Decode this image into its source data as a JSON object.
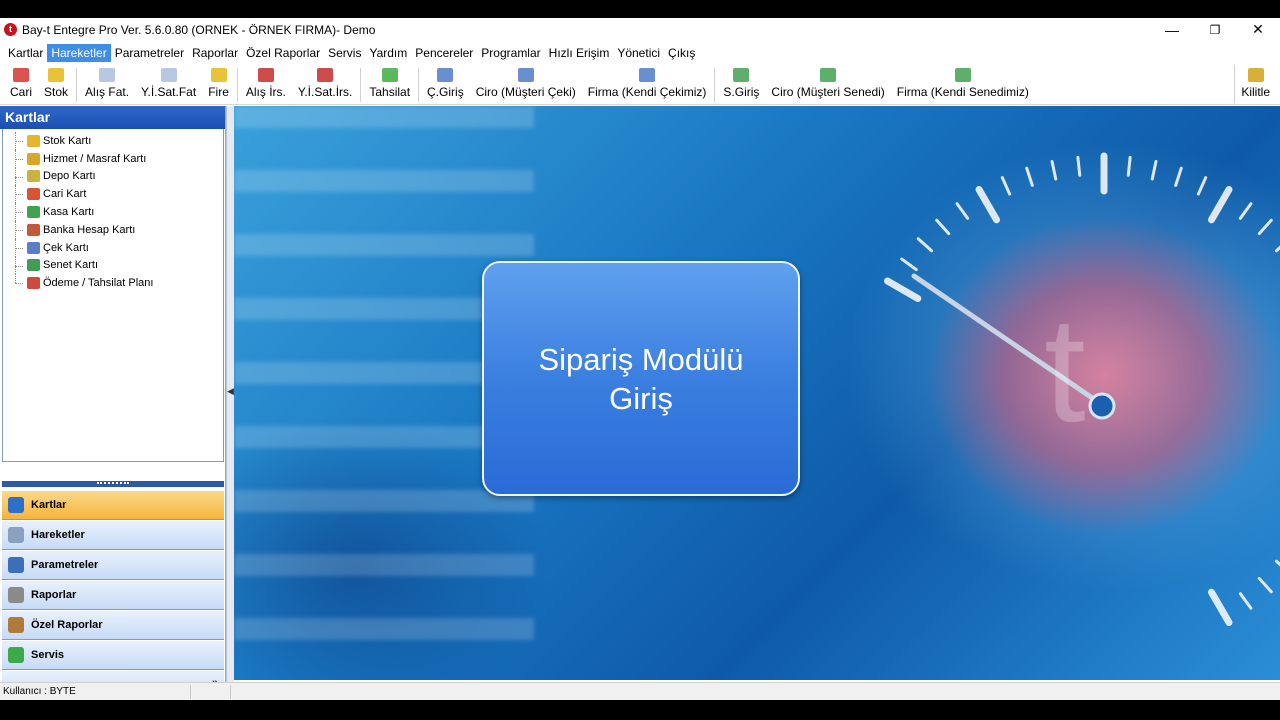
{
  "window": {
    "title": "Bay-t Entegre Pro Ver. 5.6.0.80 (ORNEK - ÖRNEK FIRMA)- Demo",
    "app_icon": "t",
    "controls": {
      "minimize": "—",
      "restore": "❐",
      "close": "✕"
    }
  },
  "menu": {
    "items": [
      {
        "label": "Kartlar"
      },
      {
        "label": "Hareketler",
        "active": true
      },
      {
        "label": "Parametreler"
      },
      {
        "label": "Raporlar"
      },
      {
        "label": "Özel Raporlar"
      },
      {
        "label": "Servis"
      },
      {
        "label": "Yardım"
      },
      {
        "label": "Pencereler"
      },
      {
        "label": "Programlar"
      },
      {
        "label": "Hızlı Erişim"
      },
      {
        "label": "Yönetici"
      },
      {
        "label": "Çıkış"
      }
    ]
  },
  "toolbar": {
    "buttons": [
      {
        "label": "Cari",
        "icon": "people-icon",
        "color": "#d9534f"
      },
      {
        "label": "Stok",
        "icon": "box-icon",
        "color": "#e8c33a"
      },
      {
        "label": "Alış Fat.",
        "icon": "invoice-icon",
        "color": "#b8c8e0"
      },
      {
        "label": "Y.İ.Sat.Fat",
        "icon": "invoice-icon",
        "color": "#b8c8e0"
      },
      {
        "label": "Fire",
        "icon": "box-icon",
        "color": "#e8c33a"
      },
      {
        "label": "Alış İrs.",
        "icon": "truck-icon",
        "color": "#cc4b4b"
      },
      {
        "label": "Y.İ.Sat.İrs.",
        "icon": "truck-icon",
        "color": "#cc4b4b"
      },
      {
        "label": "Tahsilat",
        "icon": "money-icon",
        "color": "#5cb85c"
      },
      {
        "label": "Ç.Giriş",
        "icon": "check-pen-icon",
        "color": "#6a8fd0"
      },
      {
        "label": "Ciro (Müşteri Çeki)",
        "icon": "check-pen-icon",
        "color": "#6a8fd0"
      },
      {
        "label": "Firma (Kendi Çekimiz)",
        "icon": "check-pen-icon",
        "color": "#6a8fd0"
      },
      {
        "label": "S.Giriş",
        "icon": "bill-icon",
        "color": "#5fae6a"
      },
      {
        "label": "Ciro (Müşteri Senedi)",
        "icon": "bill-icon",
        "color": "#5fae6a"
      },
      {
        "label": "Firma (Kendi Senedimiz)",
        "icon": "bill-icon",
        "color": "#5fae6a"
      }
    ],
    "lock": {
      "label": "Kilitle",
      "icon": "key-icon",
      "color": "#d6b13a"
    }
  },
  "sidebar": {
    "title": "Kartlar",
    "tree": [
      {
        "label": "Stok Kartı",
        "icon": "box-icon",
        "color": "#e2b72e"
      },
      {
        "label": "Hizmet / Masraf Kartı",
        "icon": "service-icon",
        "color": "#d9a629"
      },
      {
        "label": "Depo Kartı",
        "icon": "warehouse-icon",
        "color": "#c9b243"
      },
      {
        "label": "Cari Kart",
        "icon": "people-icon",
        "color": "#d95436"
      },
      {
        "label": "Kasa Kartı",
        "icon": "money-icon",
        "color": "#3fa34d"
      },
      {
        "label": "Banka Hesap Kartı",
        "icon": "bank-icon",
        "color": "#c05a3a"
      },
      {
        "label": "Çek Kartı",
        "icon": "check-pen-icon",
        "color": "#5a7fc8"
      },
      {
        "label": "Senet Kartı",
        "icon": "bill-icon",
        "color": "#3f9c55"
      },
      {
        "label": "Ödeme / Tahsilat Planı",
        "icon": "plan-icon",
        "color": "#cf4a3a"
      }
    ],
    "nav": [
      {
        "label": "Kartlar",
        "icon": "cards-icon",
        "color": "#2f6fc8",
        "active": true
      },
      {
        "label": "Hareketler",
        "icon": "grid-icon",
        "color": "#8aa0c0"
      },
      {
        "label": "Parametreler",
        "icon": "params-icon",
        "color": "#3c6fb8"
      },
      {
        "label": "Raporlar",
        "icon": "printer-icon",
        "color": "#8a8a8a"
      },
      {
        "label": "Özel Raporlar",
        "icon": "custom-report-icon",
        "color": "#b07a3a"
      },
      {
        "label": "Servis",
        "icon": "service-icon",
        "color": "#3ea84a"
      }
    ],
    "footer_chevron": "»"
  },
  "main": {
    "module_line1": "Sipariş Modülü",
    "module_line2": "Giriş"
  },
  "status": {
    "user": "Kullanıcı : BYTE"
  }
}
